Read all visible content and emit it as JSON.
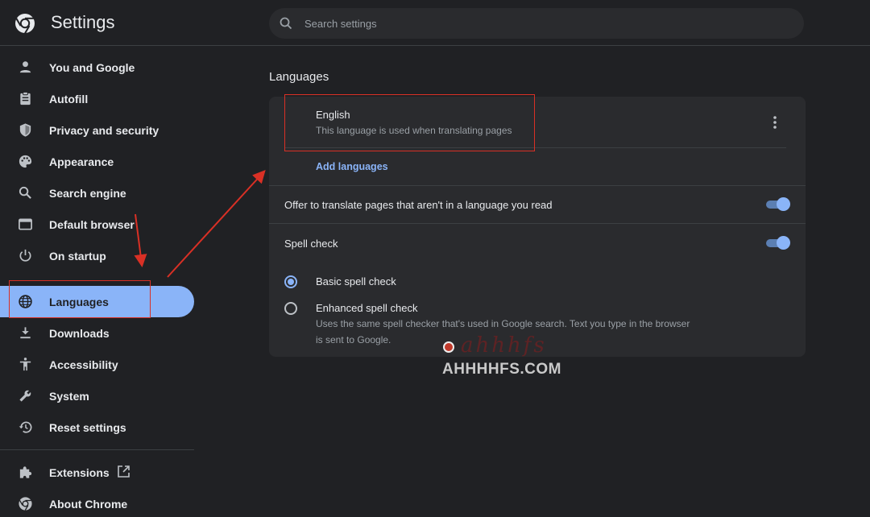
{
  "header": {
    "title": "Settings",
    "search_placeholder": "Search settings"
  },
  "sidebar": {
    "items": [
      {
        "label": "You and Google",
        "icon": "person-icon"
      },
      {
        "label": "Autofill",
        "icon": "clipboard-icon"
      },
      {
        "label": "Privacy and security",
        "icon": "shield-icon"
      },
      {
        "label": "Appearance",
        "icon": "palette-icon"
      },
      {
        "label": "Search engine",
        "icon": "search-icon"
      },
      {
        "label": "Default browser",
        "icon": "browser-window-icon"
      },
      {
        "label": "On startup",
        "icon": "power-icon"
      },
      {
        "label": "Languages",
        "icon": "globe-icon",
        "active": true
      },
      {
        "label": "Downloads",
        "icon": "download-icon"
      },
      {
        "label": "Accessibility",
        "icon": "accessibility-icon"
      },
      {
        "label": "System",
        "icon": "wrench-icon"
      },
      {
        "label": "Reset settings",
        "icon": "reset-history-icon"
      }
    ],
    "extensions": {
      "label": "Extensions",
      "icon": "puzzle-icon",
      "link_icon": "open-in-new-icon"
    },
    "about": {
      "label": "About Chrome",
      "icon": "chrome-icon"
    }
  },
  "languages": {
    "section_title": "Languages",
    "language": {
      "name": "English",
      "description": "This language is used when translating pages"
    },
    "add_languages": "Add languages",
    "offer_translate": {
      "label": "Offer to translate pages that aren't in a language you read",
      "enabled": true
    },
    "spell_check": {
      "label": "Spell check",
      "enabled": true
    },
    "spell_options": [
      {
        "label": "Basic spell check",
        "selected": true,
        "description": ""
      },
      {
        "label": "Enhanced spell check",
        "selected": false,
        "description": "Uses the same spell checker that's used in Google search. Text you type in the browser is sent to Google."
      }
    ]
  },
  "watermark": {
    "script": "ahhhfs",
    "text": "AHHHHFS.COM"
  },
  "colors": {
    "background": "#202124",
    "card": "#2a2b2e",
    "accent": "#8ab4f8",
    "annotation": "#d93025"
  }
}
